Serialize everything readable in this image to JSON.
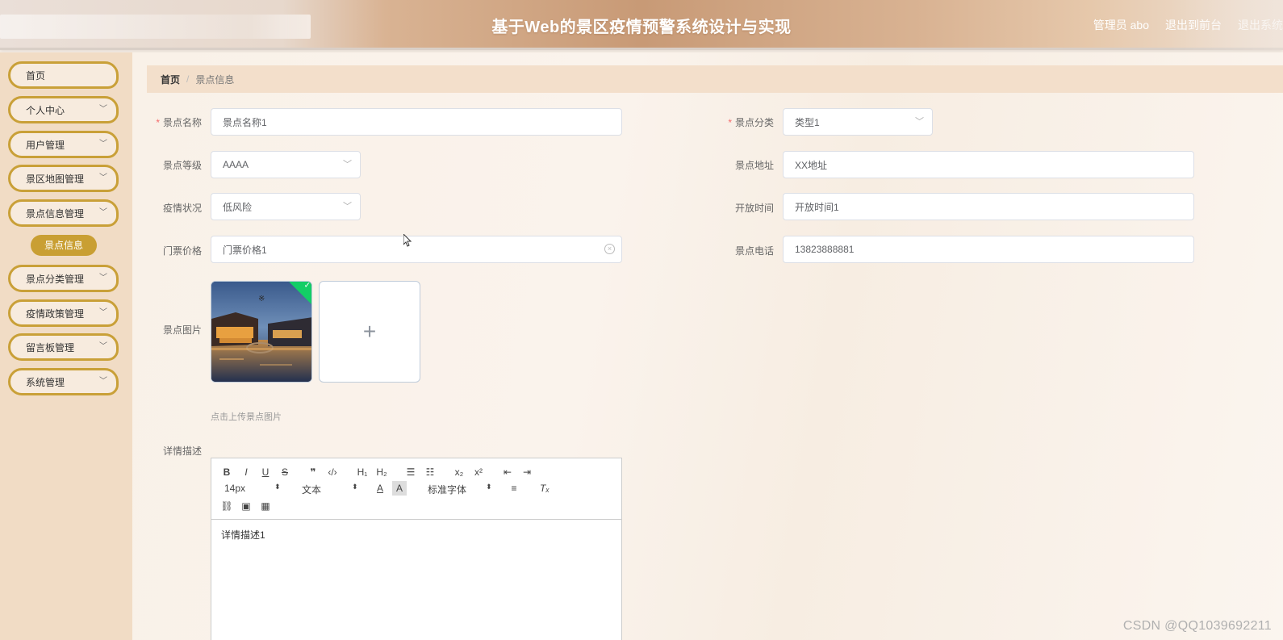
{
  "header": {
    "title": "基于Web的景区疫情预警系统设计与实现",
    "admin_label": "管理员 abo",
    "exit_front": "退出到前台",
    "exit_system": "退出系统"
  },
  "sidebar": {
    "items": [
      {
        "label": "首页",
        "has_children": false
      },
      {
        "label": "个人中心",
        "has_children": true
      },
      {
        "label": "用户管理",
        "has_children": true
      },
      {
        "label": "景区地图管理",
        "has_children": true
      },
      {
        "label": "景点信息管理",
        "has_children": true
      },
      {
        "label": "景点分类管理",
        "has_children": true
      },
      {
        "label": "疫情政策管理",
        "has_children": true
      },
      {
        "label": "留言板管理",
        "has_children": true
      },
      {
        "label": "系统管理",
        "has_children": true
      }
    ],
    "active_sub": "景点信息"
  },
  "breadcrumb": {
    "home": "首页",
    "separator": "/",
    "current": "景点信息"
  },
  "form": {
    "name": {
      "label": "景点名称",
      "value": "景点名称1",
      "required": true
    },
    "category": {
      "label": "景点分类",
      "value": "类型1",
      "required": true
    },
    "level": {
      "label": "景点等级",
      "value": "AAAA"
    },
    "address": {
      "label": "景点地址",
      "value": "XX地址"
    },
    "epidemic": {
      "label": "疫情状况",
      "value": "低风险"
    },
    "open_time": {
      "label": "开放时间",
      "value": "开放时间1"
    },
    "price": {
      "label": "门票价格",
      "value": "门票价格1"
    },
    "phone": {
      "label": "景点电话",
      "value": "13823888881"
    },
    "image": {
      "label": "景点图片",
      "tip": "点击上传景点图片",
      "add_symbol": "+"
    },
    "detail": {
      "label": "详情描述",
      "value": "详情描述1"
    }
  },
  "editor": {
    "font_size": "14px",
    "paragraph": "文本",
    "font_family": "标准字体"
  },
  "watermark": "CSDN @QQ1039692211",
  "colors": {
    "accent_gold": "#c99f33",
    "sidebar_bg": "#f1dcc5",
    "breadcrumb_bg": "#f3dfcb",
    "required": "#f56c6c",
    "upload_success": "#13ce66"
  }
}
